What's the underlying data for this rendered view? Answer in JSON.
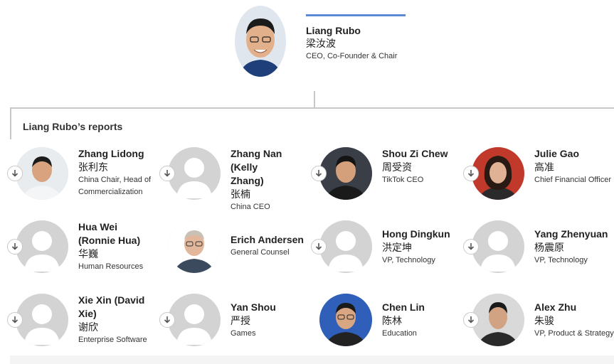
{
  "ceo": {
    "name": "Liang Rubo",
    "name_cn": "梁汝波",
    "title": "CEO, Co-Founder & Chair"
  },
  "reports_heading": "Liang Rubo’s reports",
  "reports": [
    {
      "name": "Zhang Lidong",
      "name_cn": "张利东",
      "title": "China Chair, Head of Commercialization"
    },
    {
      "name": "Zhang Nan (Kelly Zhang)",
      "name_cn": "张楠",
      "title": "China CEO"
    },
    {
      "name": "Shou Zi Chew",
      "name_cn": "周受资",
      "title": "TikTok CEO"
    },
    {
      "name": "Julie Gao",
      "name_cn": "高准",
      "title": "Chief Financial Officer"
    },
    {
      "name": "Hua Wei (Ronnie Hua)",
      "name_cn": "华巍",
      "title": "Human Resources"
    },
    {
      "name": "Erich Andersen",
      "name_cn": "",
      "title": "General Counsel"
    },
    {
      "name": "Hong Dingkun",
      "name_cn": "洪定坤",
      "title": "VP, Technology"
    },
    {
      "name": "Yang Zhenyuan",
      "name_cn": "杨震原",
      "title": "VP, Technology"
    },
    {
      "name": "Xie Xin (David Xie)",
      "name_cn": "谢欣",
      "title": "Enterprise Software"
    },
    {
      "name": "Yan Shou",
      "name_cn": "严授",
      "title": "Games"
    },
    {
      "name": "Chen Lin",
      "name_cn": "陈林",
      "title": "Education"
    },
    {
      "name": "Alex Zhu",
      "name_cn": "朱骏",
      "title": "VP, Product & Strategy"
    }
  ],
  "colors": {
    "accent": "#5b8ad6",
    "connector": "#c8c8c8",
    "placeholder": "#d3d3d3"
  }
}
